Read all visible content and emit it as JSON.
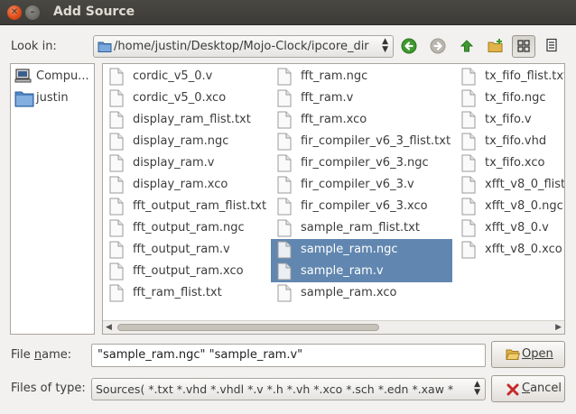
{
  "window": {
    "title": "Add Source"
  },
  "lookin": {
    "label": "Look in:",
    "path": "/home/justin/Desktop/Mojo-Clock/ipcore_dir"
  },
  "toolbar": {
    "icons": [
      "back-icon",
      "forward-icon",
      "up-icon",
      "new-folder-icon",
      "list-view-icon",
      "details-view-icon"
    ]
  },
  "places": [
    {
      "label": "Compu...",
      "icon": "computer-icon"
    },
    {
      "label": "justin",
      "icon": "folder-icon"
    }
  ],
  "files": {
    "col1": [
      "cordic_v5_0.v",
      "cordic_v5_0.xco",
      "display_ram_flist.txt",
      "display_ram.ngc",
      "display_ram.v",
      "display_ram.xco",
      "fft_output_ram_flist.txt",
      "fft_output_ram.ngc",
      "fft_output_ram.v",
      "fft_output_ram.xco",
      "fft_ram_flist.txt"
    ],
    "col2": [
      "fft_ram.ngc",
      "fft_ram.v",
      "fft_ram.xco",
      "fir_compiler_v6_3_flist.txt",
      "fir_compiler_v6_3.ngc",
      "fir_compiler_v6_3.v",
      "fir_compiler_v6_3.xco",
      "sample_ram_flist.txt",
      "sample_ram.ngc",
      "sample_ram.v",
      "sample_ram.xco"
    ],
    "col3": [
      "tx_fifo_flist.txt",
      "tx_fifo.ngc",
      "tx_fifo.v",
      "tx_fifo.vhd",
      "tx_fifo.xco",
      "xfft_v8_0_flist",
      "xfft_v8_0.ngc",
      "xfft_v8_0.v",
      "xfft_v8_0.xco"
    ],
    "selected": [
      "sample_ram.ngc",
      "sample_ram.v"
    ]
  },
  "filename": {
    "label": "File name:",
    "value": "\"sample_ram.ngc\" \"sample_ram.v\""
  },
  "filetype": {
    "label": "Files of type:",
    "value": "Sources( *.txt *.vhd *.vhdl *.v *.h *.vh *.xco *.sch *.edn *.xaw *"
  },
  "buttons": {
    "open": "Open",
    "cancel": "Cancel"
  },
  "colors": {
    "selection": "#6187b0",
    "titlebar": "#3c3b37",
    "close": "#dd4814"
  }
}
